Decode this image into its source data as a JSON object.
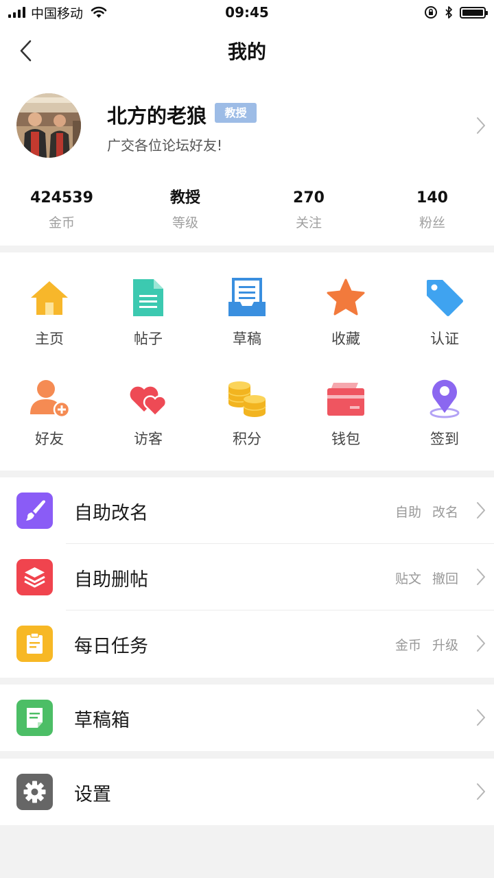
{
  "status_bar": {
    "carrier": "中国移动",
    "time": "09:45"
  },
  "header": {
    "title": "我的"
  },
  "profile": {
    "name": "北方的老狼",
    "badge": "教授",
    "bio": "广交各位论坛好友!"
  },
  "stats": [
    {
      "value": "424539",
      "label": "金币"
    },
    {
      "value": "教授",
      "label": "等级"
    },
    {
      "value": "270",
      "label": "关注"
    },
    {
      "value": "140",
      "label": "粉丝"
    }
  ],
  "grid": [
    {
      "label": "主页",
      "icon": "home-icon"
    },
    {
      "label": "帖子",
      "icon": "document-icon"
    },
    {
      "label": "草稿",
      "icon": "draft-tray-icon"
    },
    {
      "label": "收藏",
      "icon": "star-icon"
    },
    {
      "label": "认证",
      "icon": "tag-icon"
    },
    {
      "label": "好友",
      "icon": "add-friend-icon"
    },
    {
      "label": "访客",
      "icon": "hearts-icon"
    },
    {
      "label": "积分",
      "icon": "coins-icon"
    },
    {
      "label": "钱包",
      "icon": "wallet-icon"
    },
    {
      "label": "签到",
      "icon": "location-pin-icon"
    }
  ],
  "menu_group1": [
    {
      "title": "自助改名",
      "right": "自助 改名",
      "icon": "brush-icon",
      "color": "#8a5cf6"
    },
    {
      "title": "自助删帖",
      "right": "贴文 撤回",
      "icon": "layers-icon",
      "color": "#f0444e"
    },
    {
      "title": "每日任务",
      "right": "金币 升级",
      "icon": "clipboard-icon",
      "color": "#f7b825"
    }
  ],
  "menu_group2": [
    {
      "title": "草稿箱",
      "icon": "note-icon",
      "color": "#4cbe66"
    }
  ],
  "menu_group3": [
    {
      "title": "设置",
      "icon": "gear-icon",
      "color": "#666666"
    }
  ]
}
